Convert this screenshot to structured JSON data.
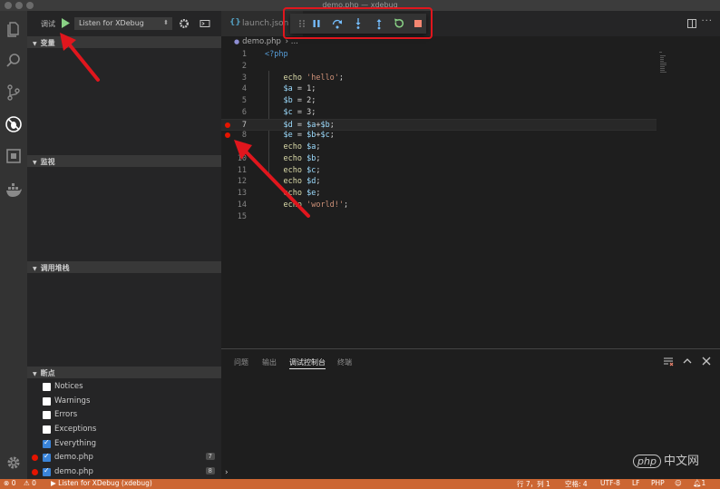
{
  "window": {
    "title": "demo.php — xdebug"
  },
  "debug_toolbar": {
    "label": "调试",
    "configuration": "Listen for XDebug"
  },
  "sidebar": {
    "sections": {
      "variables": "变量",
      "watch": "监视",
      "call_stack": "调用堆栈",
      "breakpoints": "断点"
    },
    "breakpoint_options": [
      {
        "label": "Notices",
        "checked": false
      },
      {
        "label": "Warnings",
        "checked": false
      },
      {
        "label": "Errors",
        "checked": false
      },
      {
        "label": "Exceptions",
        "checked": false
      },
      {
        "label": "Everything",
        "checked": true
      }
    ],
    "breakpoint_files": [
      {
        "label": "demo.php",
        "line": "7"
      },
      {
        "label": "demo.php",
        "line": "8"
      }
    ]
  },
  "editor": {
    "tab_label": "launch.json",
    "breadcrumb": "demo.php",
    "breadcrumb_more": "...",
    "lines": [
      {
        "n": "1",
        "code": "<?php"
      },
      {
        "n": "2",
        "code": ""
      },
      {
        "n": "3",
        "code": "    echo 'hello';"
      },
      {
        "n": "4",
        "code": "    $a = 1;"
      },
      {
        "n": "5",
        "code": "    $b = 2;"
      },
      {
        "n": "6",
        "code": "    $c = 3;"
      },
      {
        "n": "7",
        "code": "    $d = $a+$b;"
      },
      {
        "n": "8",
        "code": "    $e = $b+$c;"
      },
      {
        "n": "9",
        "code": "    echo $a;"
      },
      {
        "n": "10",
        "code": "    echo $b;"
      },
      {
        "n": "11",
        "code": "    echo $c;"
      },
      {
        "n": "12",
        "code": "    echo $d;"
      },
      {
        "n": "13",
        "code": "    echo $e;"
      },
      {
        "n": "14",
        "code": "    echo 'world!';"
      },
      {
        "n": "15",
        "code": ""
      }
    ]
  },
  "panel": {
    "tabs": [
      "问题",
      "输出",
      "调试控制台",
      "终端"
    ],
    "active_tab": "调试控制台",
    "prompt": "›"
  },
  "statusbar": {
    "errors": "0",
    "warnings": "0",
    "debug_config": "Listen for XDebug (xdebug)",
    "position": "行 7，列 1",
    "spaces": "空格: 4",
    "encoding": "UTF-8",
    "eol": "LF",
    "language": "PHP",
    "notifications": "1"
  },
  "watermark": {
    "badge": "php",
    "text": "中文网"
  },
  "colors": {
    "statusbar": "#cc6633",
    "breakpoint": "#e51400",
    "annotation": "#e0161d",
    "continue": "#89d185",
    "restart": "#89d185",
    "stop": "#f48771",
    "step": "#75beff"
  }
}
